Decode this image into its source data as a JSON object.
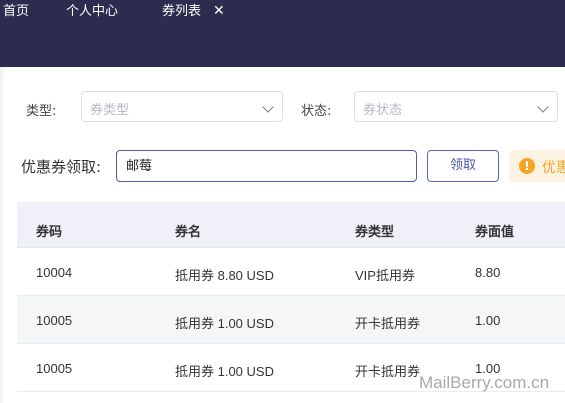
{
  "nav": {
    "tabs": [
      {
        "label": "首页"
      },
      {
        "label": "个人中心"
      },
      {
        "label": "券列表"
      }
    ],
    "close_symbol": "✕"
  },
  "filters": {
    "type_label": "类型:",
    "type_placeholder": "券类型",
    "status_label": "状态:",
    "status_placeholder": "券状态"
  },
  "claim": {
    "label": "优惠券领取:",
    "input_value": "邮莓",
    "button_label": "领取",
    "notice_text": "优惠",
    "notice_icon": "warning-icon"
  },
  "table": {
    "headers": [
      "券码",
      "券名",
      "券类型",
      "券面值"
    ],
    "rows": [
      {
        "code": "10004",
        "name": "抵用券 8.80 USD",
        "type": "VIP抵用券",
        "value": "8.80"
      },
      {
        "code": "10005",
        "name": "抵用券 1.00 USD",
        "type": "开卡抵用券",
        "value": "1.00"
      },
      {
        "code": "10005",
        "name": "抵用券 1.00 USD",
        "type": "开卡抵用券",
        "value": "1.00"
      }
    ]
  },
  "watermark": "MailBerry.com.cn",
  "colors": {
    "topbar": "#2c2c4e",
    "accent": "#4a56a2",
    "warning": "#f4a526"
  }
}
